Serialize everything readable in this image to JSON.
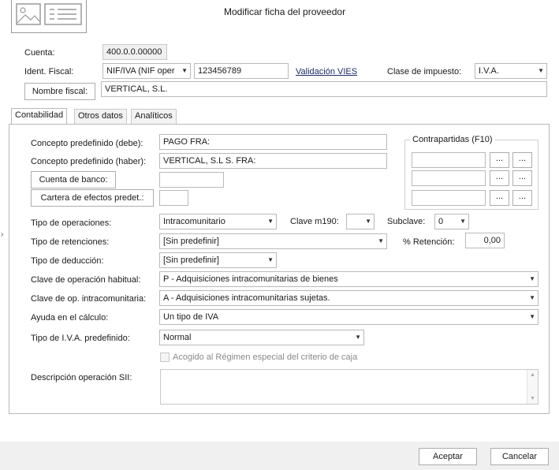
{
  "dialog": {
    "title": "Modificar ficha del proveedor"
  },
  "header": {
    "cuenta_label": "Cuenta:",
    "cuenta_value": "400.0.0.00000",
    "ident_label": "Ident. Fiscal:",
    "ident_type": "NIF/IVA (NIF oper",
    "ident_value": "123456789",
    "vies_link": "Validación VIES",
    "clase_label": "Clase de impuesto:",
    "clase_value": "I.V.A.",
    "nombre_button": "Nombre fiscal:",
    "nombre_value": "VERTICAL, S.L."
  },
  "tabs": [
    {
      "label": "Contabilidad",
      "active": true
    },
    {
      "label": "Otros datos",
      "active": false
    },
    {
      "label": "Analíticos",
      "active": false
    }
  ],
  "contabilidad": {
    "concepto_debe_label": "Concepto predefinido (debe):",
    "concepto_debe_value": "PAGO FRA:",
    "concepto_haber_label": "Concepto predefinido (haber):",
    "concepto_haber_value": "VERTICAL, S.L S. FRA:",
    "cuenta_banco_button": "Cuenta de banco:",
    "cuenta_banco_value": "",
    "cartera_button": "Cartera de efectos predet.:",
    "cartera_value": "",
    "contrapartidas_title": "Contrapartidas (F10)",
    "dots_label": "...",
    "tipo_operaciones_label": "Tipo de operaciones:",
    "tipo_operaciones_value": "Intracomunitario",
    "clave_m190_label": "Clave m190:",
    "clave_m190_value": "",
    "subclave_label": "Subclave:",
    "subclave_value": "0",
    "tipo_retenciones_label": "Tipo de retenciones:",
    "tipo_retenciones_value": "[Sin predefinir]",
    "retencion_label": "% Retención:",
    "retencion_value": "0,00",
    "tipo_deduccion_label": "Tipo de deducción:",
    "tipo_deduccion_value": "[Sin predefinir]",
    "clave_habitual_label": "Clave de operación habitual:",
    "clave_habitual_value": "P - Adquisiciones intracomunitarias de bienes",
    "clave_intra_label": "Clave de op. intracomunitaria:",
    "clave_intra_value": "A - Adquisiciones intracomunitarias sujetas.",
    "ayuda_label": "Ayuda en el cálculo:",
    "ayuda_value": "Un tipo de IVA",
    "tipo_iva_label": "Tipo de I.V.A. predefinido:",
    "tipo_iva_value": "Normal",
    "acogido_label": "Acogido al Régimen especial del criterio de caja",
    "descripcion_label": "Descripción operación SII:",
    "descripcion_value": ""
  },
  "footer": {
    "accept": "Aceptar",
    "cancel": "Cancelar"
  },
  "colors": {
    "link": "#1c2b66",
    "border": "#b9b9b9",
    "footer_bg": "#f0f0f0"
  }
}
